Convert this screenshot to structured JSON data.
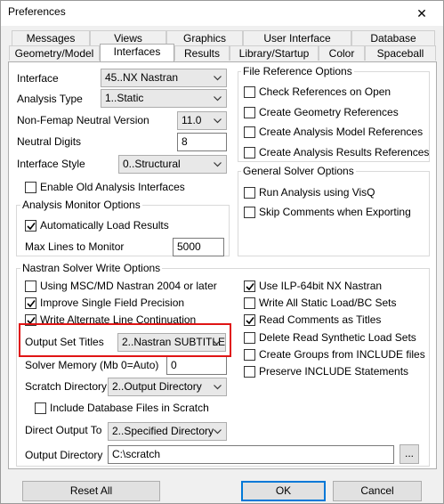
{
  "window": {
    "title": "Preferences",
    "close_glyph": "✕"
  },
  "tabs_row1": [
    {
      "label": "Messages"
    },
    {
      "label": "Views"
    },
    {
      "label": "Graphics"
    },
    {
      "label": "User Interface"
    },
    {
      "label": "Database"
    }
  ],
  "tabs_row2": [
    {
      "label": "Geometry/Model"
    },
    {
      "label": "Interfaces"
    },
    {
      "label": "Results"
    },
    {
      "label": "Library/Startup"
    },
    {
      "label": "Color"
    },
    {
      "label": "Spaceball"
    }
  ],
  "left": {
    "interface": {
      "label": "Interface",
      "value": "45..NX Nastran"
    },
    "analysis_type": {
      "label": "Analysis Type",
      "value": "1..Static"
    },
    "neutral_version": {
      "label": "Non-Femap Neutral Version",
      "value": "11.0"
    },
    "neutral_digits": {
      "label": "Neutral Digits",
      "value": "8"
    },
    "interface_style": {
      "label": "Interface Style",
      "value": "0..Structural"
    },
    "enable_old": {
      "label": "Enable Old Analysis Interfaces",
      "checked": false
    }
  },
  "monitor": {
    "title": "Analysis Monitor Options",
    "auto_load": {
      "label": "Automatically Load Results",
      "checked": true
    },
    "max_lines": {
      "label": "Max Lines to Monitor",
      "value": "5000"
    }
  },
  "file_ref": {
    "title": "File Reference Options",
    "items": [
      {
        "label": "Check References on Open",
        "checked": false
      },
      {
        "label": "Create Geometry References",
        "checked": false
      },
      {
        "label": "Create Analysis Model References",
        "checked": false
      },
      {
        "label": "Create Analysis Results References",
        "checked": false
      }
    ]
  },
  "general_solver": {
    "title": "General Solver Options",
    "items": [
      {
        "label": "Run Analysis using VisQ",
        "checked": false
      },
      {
        "label": "Skip Comments when Exporting",
        "checked": false
      }
    ]
  },
  "nastran": {
    "title": "Nastran Solver Write Options",
    "left_items": [
      {
        "label": "Using MSC/MD Nastran 2004 or later",
        "checked": false
      },
      {
        "label": "Improve Single Field Precision",
        "checked": true
      },
      {
        "label": "Write Alternate Line Continuation",
        "checked": true
      }
    ],
    "right_items": [
      {
        "label": "Use ILP-64bit NX Nastran",
        "checked": true
      },
      {
        "label": "Write All Static Load/BC Sets",
        "checked": false
      },
      {
        "label": "Read Comments as Titles",
        "checked": true
      },
      {
        "label": "Delete Read Synthetic Load Sets",
        "checked": false
      },
      {
        "label": "Create Groups from INCLUDE files",
        "checked": false
      },
      {
        "label": "Preserve INCLUDE Statements",
        "checked": false
      }
    ],
    "output_set_titles": {
      "label": "Output Set Titles",
      "value": "2..Nastran SUBTITLE"
    },
    "solver_memory": {
      "label": "Solver Memory (Mb 0=Auto)",
      "value": "0"
    },
    "scratch_dir": {
      "label": "Scratch Directory",
      "value": "2..Output Directory"
    },
    "include_db": {
      "label": "Include Database Files in Scratch",
      "checked": false
    },
    "direct_output": {
      "label": "Direct Output To",
      "value": "2..Specified Directory"
    },
    "output_dir": {
      "label": "Output Directory",
      "value": "C:\\scratch",
      "browse_label": "..."
    }
  },
  "buttons": {
    "reset_all": "Reset All",
    "ok": "OK",
    "cancel": "Cancel"
  },
  "colors": {
    "highlight": "#e01414",
    "check": "#000000",
    "default_border": "#0078d7"
  }
}
